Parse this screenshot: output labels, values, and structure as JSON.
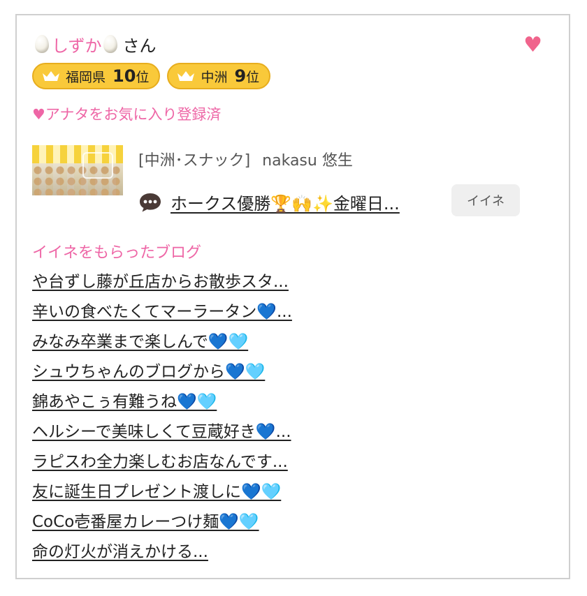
{
  "user": {
    "name": "しずか",
    "suffix": "さん",
    "icon": "egg-emoji"
  },
  "favorite_icon": "heart-icon",
  "accent_color": "#ee66a6",
  "badge_color": "#f9c93a",
  "badges": [
    {
      "area": "福岡県",
      "rank": "10",
      "suffix": "位",
      "icon": "crown-icon"
    },
    {
      "area": "中洲",
      "rank": "9",
      "suffix": "位",
      "icon": "crown-icon"
    }
  ],
  "favorite_note": "♥アナタをお気に入り登録済",
  "shop": {
    "category": "[中洲･スナック]",
    "name": "nakasu 悠生"
  },
  "latest_post": {
    "icon": "speech-bubble-icon",
    "title": "ホークス優勝🏆🙌✨金曜日..."
  },
  "like_button": "イイネ",
  "liked_blogs": {
    "title": "イイネをもらったブログ",
    "items": [
      "や台ずし藤が丘店からお散歩スタ...",
      "辛いの食べたくてマーラータン💙...",
      "みなみ卒業まで楽しんで💙🩵",
      "シュウちゃんのブログから💙🩵",
      "錦あやこぅ有難うね💙🩵",
      "ヘルシーで美味しくて豆蔵好き💙...",
      "ラピスわ全力楽しむお店なんです...",
      "友に誕生日プレゼント渡しに💙🩵",
      "CoCo壱番屋カレーつけ麺💙🩵",
      "命の灯火が消えかける..."
    ]
  }
}
